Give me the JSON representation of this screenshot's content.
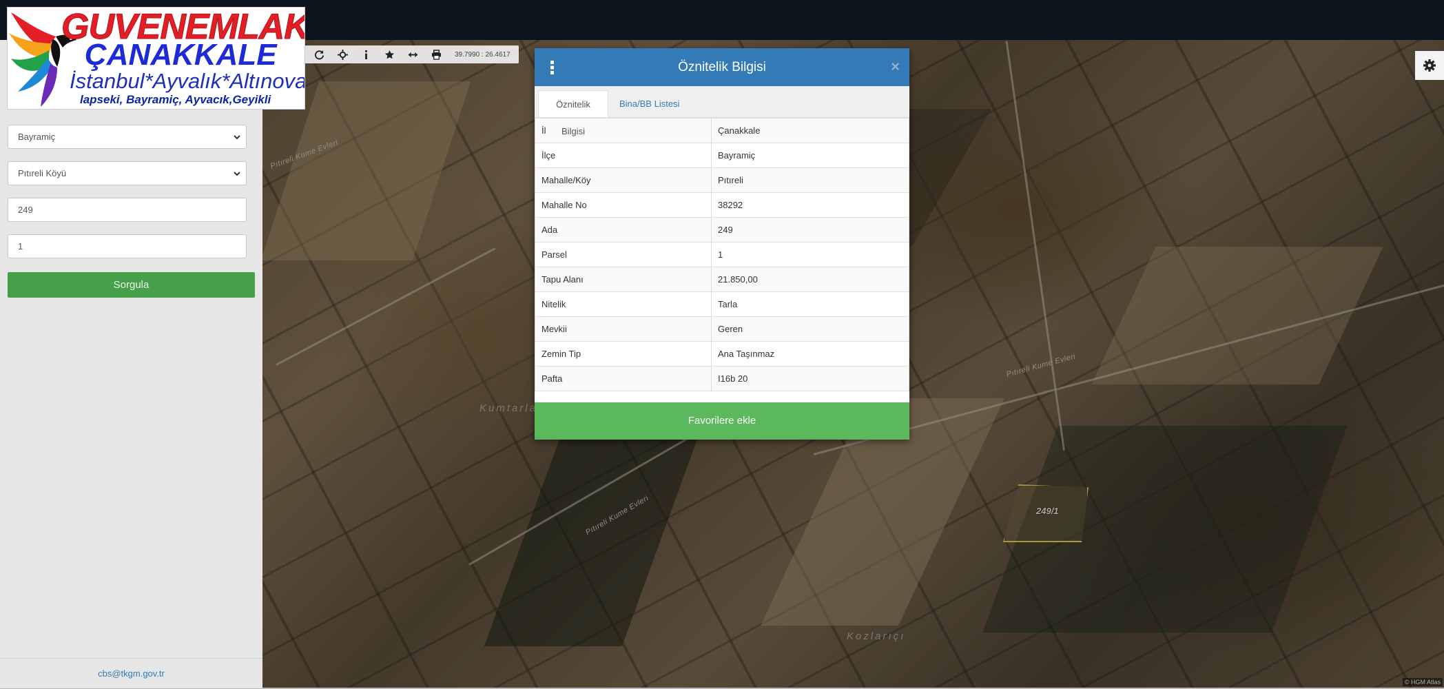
{
  "logo": {
    "line1": "GUVENEMLAK",
    "line2": "ÇANAKKALE",
    "line3": "İstanbul*Ayvalık*Altınova",
    "line4": "lapseki, Bayramiç, Ayvacık,Geyikli",
    "colors": {
      "red": "#e41e26",
      "blue": "#1d2bd6"
    }
  },
  "sidebar": {
    "district_select": "Bayramiç",
    "neighborhood_select": "Pıtıreli Köyü",
    "block_input": "249",
    "parcel_input": "1",
    "query_button": "Sorgula",
    "footer_email": "cbs@tkgm.gov.tr"
  },
  "toolbar": {
    "icons": [
      "refresh-icon",
      "crosshair-icon",
      "info-icon",
      "star-icon",
      "measure-icon",
      "print-icon"
    ],
    "coordinates": "39.7990 : 26.4617"
  },
  "map": {
    "labels": {
      "place1": "Kumtarla",
      "place2": "Kozlarıçı",
      "road1": "Pıtıreli Kume Evleri",
      "parcel": "249/1"
    },
    "attribution": "© HGM Atlas",
    "parcel_outline_color": "#e8d35a"
  },
  "modal": {
    "title": "Öznitelik Bilgisi",
    "close": "×",
    "tabs": [
      "Öznitelik Bilgisi",
      "Bina/BB Listesi"
    ],
    "rows": [
      {
        "key": "İl",
        "value": "Çanakkale"
      },
      {
        "key": "İlçe",
        "value": "Bayramiç"
      },
      {
        "key": "Mahalle/Köy",
        "value": "Pıtıreli"
      },
      {
        "key": "Mahalle No",
        "value": "38292"
      },
      {
        "key": "Ada",
        "value": "249"
      },
      {
        "key": "Parsel",
        "value": "1"
      },
      {
        "key": "Tapu Alanı",
        "value": "21.850,00"
      },
      {
        "key": "Nitelik",
        "value": "Tarla"
      },
      {
        "key": "Mevkii",
        "value": "Geren"
      },
      {
        "key": "Zemin Tip",
        "value": "Ana Taşınmaz"
      },
      {
        "key": "Pafta",
        "value": "I16b 20"
      }
    ],
    "favorite_button": "Favorilere ekle",
    "header_color": "#337ab7",
    "button_color": "#5cb85c"
  }
}
